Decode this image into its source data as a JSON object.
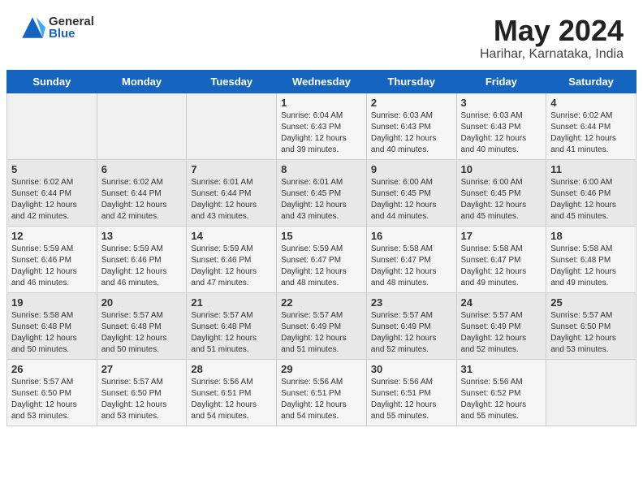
{
  "header": {
    "logo_general": "General",
    "logo_blue": "Blue",
    "month_year": "May 2024",
    "location": "Harihar, Karnataka, India"
  },
  "days_of_week": [
    "Sunday",
    "Monday",
    "Tuesday",
    "Wednesday",
    "Thursday",
    "Friday",
    "Saturday"
  ],
  "weeks": [
    [
      {
        "num": "",
        "info": ""
      },
      {
        "num": "",
        "info": ""
      },
      {
        "num": "",
        "info": ""
      },
      {
        "num": "1",
        "info": "Sunrise: 6:04 AM\nSunset: 6:43 PM\nDaylight: 12 hours\nand 39 minutes."
      },
      {
        "num": "2",
        "info": "Sunrise: 6:03 AM\nSunset: 6:43 PM\nDaylight: 12 hours\nand 40 minutes."
      },
      {
        "num": "3",
        "info": "Sunrise: 6:03 AM\nSunset: 6:43 PM\nDaylight: 12 hours\nand 40 minutes."
      },
      {
        "num": "4",
        "info": "Sunrise: 6:02 AM\nSunset: 6:44 PM\nDaylight: 12 hours\nand 41 minutes."
      }
    ],
    [
      {
        "num": "5",
        "info": "Sunrise: 6:02 AM\nSunset: 6:44 PM\nDaylight: 12 hours\nand 42 minutes."
      },
      {
        "num": "6",
        "info": "Sunrise: 6:02 AM\nSunset: 6:44 PM\nDaylight: 12 hours\nand 42 minutes."
      },
      {
        "num": "7",
        "info": "Sunrise: 6:01 AM\nSunset: 6:44 PM\nDaylight: 12 hours\nand 43 minutes."
      },
      {
        "num": "8",
        "info": "Sunrise: 6:01 AM\nSunset: 6:45 PM\nDaylight: 12 hours\nand 43 minutes."
      },
      {
        "num": "9",
        "info": "Sunrise: 6:00 AM\nSunset: 6:45 PM\nDaylight: 12 hours\nand 44 minutes."
      },
      {
        "num": "10",
        "info": "Sunrise: 6:00 AM\nSunset: 6:45 PM\nDaylight: 12 hours\nand 45 minutes."
      },
      {
        "num": "11",
        "info": "Sunrise: 6:00 AM\nSunset: 6:46 PM\nDaylight: 12 hours\nand 45 minutes."
      }
    ],
    [
      {
        "num": "12",
        "info": "Sunrise: 5:59 AM\nSunset: 6:46 PM\nDaylight: 12 hours\nand 46 minutes."
      },
      {
        "num": "13",
        "info": "Sunrise: 5:59 AM\nSunset: 6:46 PM\nDaylight: 12 hours\nand 46 minutes."
      },
      {
        "num": "14",
        "info": "Sunrise: 5:59 AM\nSunset: 6:46 PM\nDaylight: 12 hours\nand 47 minutes."
      },
      {
        "num": "15",
        "info": "Sunrise: 5:59 AM\nSunset: 6:47 PM\nDaylight: 12 hours\nand 48 minutes."
      },
      {
        "num": "16",
        "info": "Sunrise: 5:58 AM\nSunset: 6:47 PM\nDaylight: 12 hours\nand 48 minutes."
      },
      {
        "num": "17",
        "info": "Sunrise: 5:58 AM\nSunset: 6:47 PM\nDaylight: 12 hours\nand 49 minutes."
      },
      {
        "num": "18",
        "info": "Sunrise: 5:58 AM\nSunset: 6:48 PM\nDaylight: 12 hours\nand 49 minutes."
      }
    ],
    [
      {
        "num": "19",
        "info": "Sunrise: 5:58 AM\nSunset: 6:48 PM\nDaylight: 12 hours\nand 50 minutes."
      },
      {
        "num": "20",
        "info": "Sunrise: 5:57 AM\nSunset: 6:48 PM\nDaylight: 12 hours\nand 50 minutes."
      },
      {
        "num": "21",
        "info": "Sunrise: 5:57 AM\nSunset: 6:48 PM\nDaylight: 12 hours\nand 51 minutes."
      },
      {
        "num": "22",
        "info": "Sunrise: 5:57 AM\nSunset: 6:49 PM\nDaylight: 12 hours\nand 51 minutes."
      },
      {
        "num": "23",
        "info": "Sunrise: 5:57 AM\nSunset: 6:49 PM\nDaylight: 12 hours\nand 52 minutes."
      },
      {
        "num": "24",
        "info": "Sunrise: 5:57 AM\nSunset: 6:49 PM\nDaylight: 12 hours\nand 52 minutes."
      },
      {
        "num": "25",
        "info": "Sunrise: 5:57 AM\nSunset: 6:50 PM\nDaylight: 12 hours\nand 53 minutes."
      }
    ],
    [
      {
        "num": "26",
        "info": "Sunrise: 5:57 AM\nSunset: 6:50 PM\nDaylight: 12 hours\nand 53 minutes."
      },
      {
        "num": "27",
        "info": "Sunrise: 5:57 AM\nSunset: 6:50 PM\nDaylight: 12 hours\nand 53 minutes."
      },
      {
        "num": "28",
        "info": "Sunrise: 5:56 AM\nSunset: 6:51 PM\nDaylight: 12 hours\nand 54 minutes."
      },
      {
        "num": "29",
        "info": "Sunrise: 5:56 AM\nSunset: 6:51 PM\nDaylight: 12 hours\nand 54 minutes."
      },
      {
        "num": "30",
        "info": "Sunrise: 5:56 AM\nSunset: 6:51 PM\nDaylight: 12 hours\nand 55 minutes."
      },
      {
        "num": "31",
        "info": "Sunrise: 5:56 AM\nSunset: 6:52 PM\nDaylight: 12 hours\nand 55 minutes."
      },
      {
        "num": "",
        "info": ""
      }
    ]
  ]
}
